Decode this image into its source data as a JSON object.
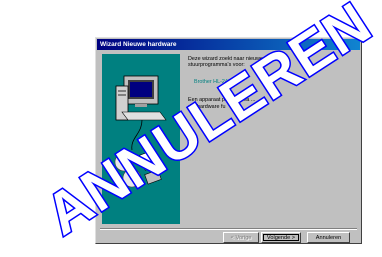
{
  "window": {
    "title": "Wizard Nieuwe hardware"
  },
  "content": {
    "intro": "Deze wizard zoekt naar nieuwe\nstuurprogramma's voor:",
    "device": "Brother HL-2460 se",
    "hint": "Een apparaat          programma          ...\ndat hardware fu"
  },
  "buttons": {
    "back": "< Vorige",
    "next": "Volgende >",
    "cancel": "Annuleren"
  },
  "watermark": {
    "text": "ANNULEREN",
    "color": "#0000ff"
  },
  "colors": {
    "title_start": "#000080",
    "title_end": "#1084d0",
    "dialog_face": "#c0c0c0",
    "device_text": "#008080"
  }
}
